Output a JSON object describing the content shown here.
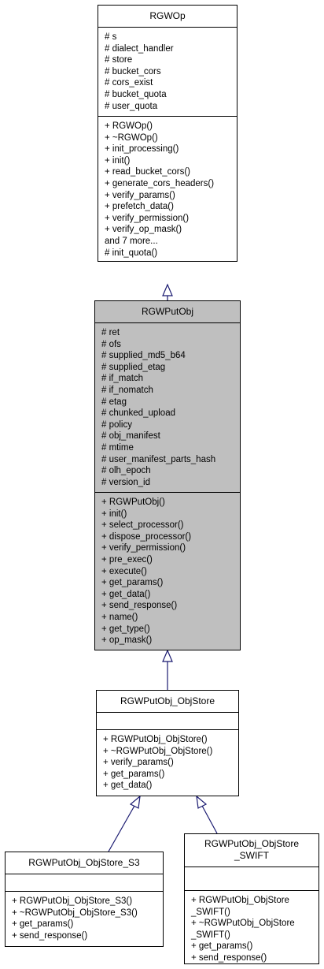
{
  "classes": {
    "rgwop": {
      "name": "RGWOp",
      "attributes": [
        "# s",
        "# dialect_handler",
        "# store",
        "# bucket_cors",
        "# cors_exist",
        "# bucket_quota",
        "# user_quota"
      ],
      "methods": [
        "+ RGWOp()",
        "+ ~RGWOp()",
        "+ init_processing()",
        "+ init()",
        "+ read_bucket_cors()",
        "+ generate_cors_headers()",
        "+ verify_params()",
        "+ prefetch_data()",
        "+ verify_permission()",
        "+ verify_op_mask()",
        "and 7 more...",
        "# init_quota()"
      ]
    },
    "rgwputobj": {
      "name": "RGWPutObj",
      "attributes": [
        "# ret",
        "# ofs",
        "# supplied_md5_b64",
        "# supplied_etag",
        "# if_match",
        "# if_nomatch",
        "# etag",
        "# chunked_upload",
        "# policy",
        "# obj_manifest",
        "# mtime",
        "# user_manifest_parts_hash",
        "# olh_epoch",
        "# version_id"
      ],
      "methods": [
        "+ RGWPutObj()",
        "+ init()",
        "+ select_processor()",
        "+ dispose_processor()",
        "+ verify_permission()",
        "+ pre_exec()",
        "+ execute()",
        "+ get_params()",
        "+ get_data()",
        "+ send_response()",
        "+ name()",
        "+ get_type()",
        "+ op_mask()"
      ]
    },
    "objstore": {
      "name": "RGWPutObj_ObjStore",
      "attributes": [],
      "methods": [
        "+ RGWPutObj_ObjStore()",
        "+ ~RGWPutObj_ObjStore()",
        "+ verify_params()",
        "+ get_params()",
        "+ get_data()"
      ]
    },
    "s3": {
      "name": "RGWPutObj_ObjStore_S3",
      "attributes": [],
      "methods": [
        "+ RGWPutObj_ObjStore_S3()",
        "+ ~RGWPutObj_ObjStore_S3()",
        "+ get_params()",
        "+ send_response()"
      ]
    },
    "swift": {
      "name_lines": [
        "RGWPutObj_ObjStore",
        "_SWIFT"
      ],
      "attributes": [],
      "methods": [
        "+ RGWPutObj_ObjStore",
        "_SWIFT()",
        "+ ~RGWPutObj_ObjStore",
        "_SWIFT()",
        "+ get_params()",
        "+ send_response()"
      ]
    }
  },
  "colors": {
    "edge": "#191970",
    "highlight_fill": "#bfbfbf",
    "border": "#000000"
  }
}
